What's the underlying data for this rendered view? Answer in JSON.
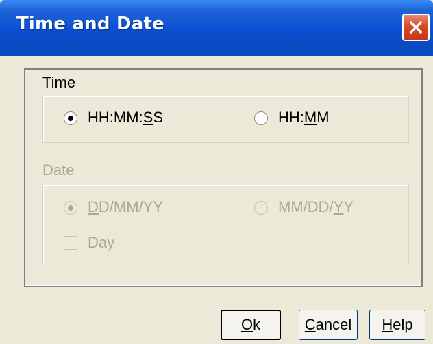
{
  "window": {
    "title": "Time and Date"
  },
  "time_group": {
    "label": "Time",
    "options": [
      {
        "pre": "HH:MM:",
        "u": "S",
        "post": "S",
        "selected": true
      },
      {
        "pre": "HH:",
        "u": "M",
        "post": "M",
        "selected": false
      }
    ]
  },
  "date_group": {
    "label": "Date",
    "enabled": false,
    "options": [
      {
        "pre": "",
        "u": "D",
        "post": "D/MM/YY",
        "selected": true
      },
      {
        "pre": "MM/DD/",
        "u": "Y",
        "post": "Y",
        "selected": false
      }
    ],
    "day_checkbox": {
      "label": "Day",
      "checked": false
    }
  },
  "buttons": {
    "ok": {
      "pre": "",
      "u": "O",
      "post": "k"
    },
    "cancel": {
      "pre": "",
      "u": "C",
      "post": "ancel"
    },
    "help": {
      "pre": "",
      "u": "H",
      "post": "elp"
    }
  },
  "colors": {
    "titlebar": "#0a4fd0",
    "close": "#c5391b",
    "dialog_bg": "#ece9d8",
    "disabled_text": "#aca899"
  }
}
